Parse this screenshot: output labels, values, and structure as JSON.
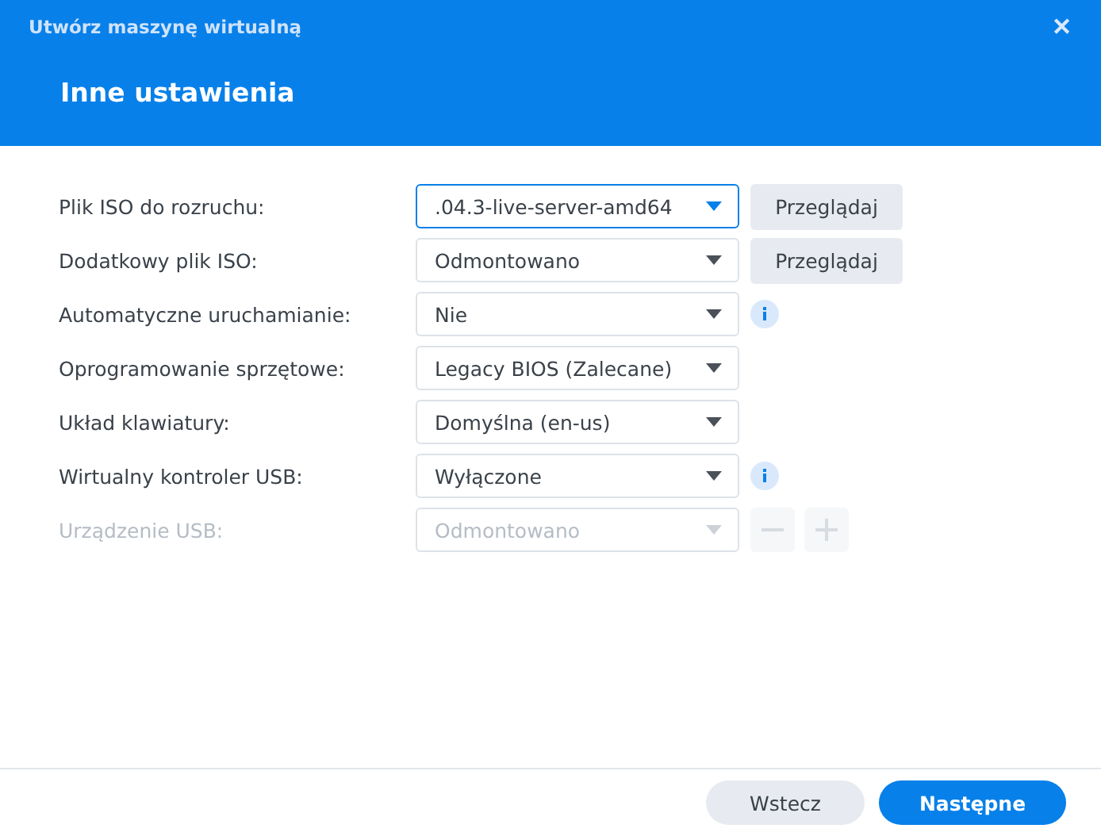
{
  "window": {
    "title": "Utwórz maszynę wirtualną",
    "close": "✕"
  },
  "heading": "Inne ustawienia",
  "rows": [
    {
      "label": "Plik ISO do rozruchu:",
      "value": ".04.3-live-server-amd64",
      "focused": true,
      "disabled": false,
      "kind": "browse",
      "button": "Przeglądaj"
    },
    {
      "label": "Dodatkowy plik ISO:",
      "value": "Odmontowano",
      "focused": false,
      "disabled": false,
      "kind": "browse",
      "button": "Przeglądaj"
    },
    {
      "label": "Automatyczne uruchamianie:",
      "value": "Nie",
      "focused": false,
      "disabled": false,
      "kind": "info"
    },
    {
      "label": "Oprogramowanie sprzętowe:",
      "value": "Legacy BIOS (Zalecane)",
      "focused": false,
      "disabled": false,
      "kind": "plain"
    },
    {
      "label": "Układ klawiatury:",
      "value": "Domyślna (en-us)",
      "focused": false,
      "disabled": false,
      "kind": "plain"
    },
    {
      "label": "Wirtualny kontroler USB:",
      "value": "Wyłączone",
      "focused": false,
      "disabled": false,
      "kind": "info"
    },
    {
      "label": "Urządzenie USB:",
      "value": "Odmontowano",
      "focused": false,
      "disabled": true,
      "kind": "stepper"
    }
  ],
  "footer": {
    "back": "Wstecz",
    "next": "Następne"
  }
}
